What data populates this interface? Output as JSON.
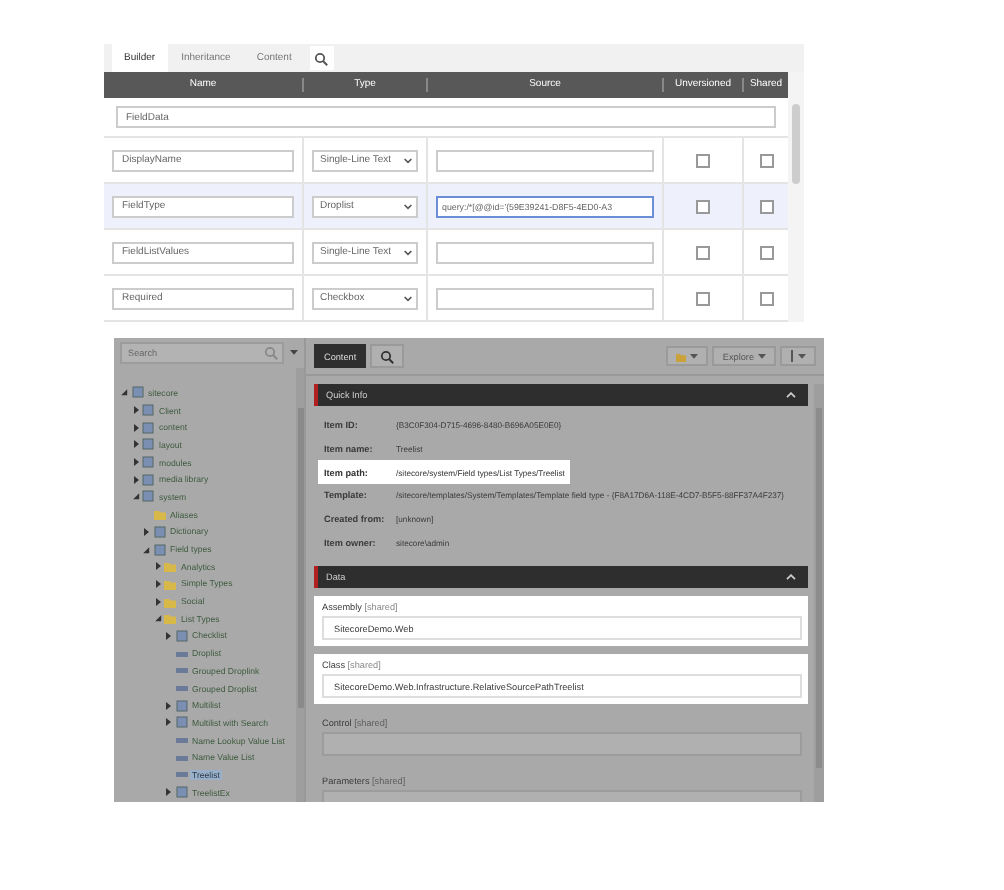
{
  "builder": {
    "tabs": [
      {
        "label": "Builder",
        "selected": true
      },
      {
        "label": "Inheritance",
        "selected": false
      },
      {
        "label": "Content",
        "selected": false
      }
    ],
    "columns": [
      "Name",
      "Type",
      "Source",
      "Unversioned",
      "Shared"
    ],
    "section_name": "FieldData",
    "rows": [
      {
        "name": "DisplayName",
        "type": "Single-Line Text",
        "unversioned": false,
        "shared": false,
        "selected": false
      },
      {
        "name": "FieldType",
        "type": "Droplist",
        "source": "query:/*[@@id='{59E39241-D8F5-4ED0-A3",
        "unversioned": false,
        "shared": false,
        "selected": true
      },
      {
        "name": "FieldListValues",
        "type": "Single-Line Text",
        "unversioned": false,
        "shared": false,
        "selected": false
      },
      {
        "name": "Required",
        "type": "Checkbox",
        "unversioned": false,
        "shared": false,
        "selected": false
      }
    ]
  },
  "explorer": {
    "search": {
      "placeholder": "Search"
    },
    "tree": [
      {
        "label": "sitecore",
        "kind": "item",
        "expanded": true,
        "selected": false,
        "children": [
          {
            "label": "Client",
            "kind": "item",
            "expanded": false,
            "selected": false
          },
          {
            "label": "content",
            "kind": "item",
            "expanded": false,
            "selected": false
          },
          {
            "label": "layout",
            "kind": "item",
            "expanded": false,
            "selected": false
          },
          {
            "label": "modules",
            "kind": "item",
            "expanded": false,
            "selected": false
          },
          {
            "label": "media library",
            "kind": "item",
            "expanded": false,
            "selected": false
          },
          {
            "label": "system",
            "kind": "item",
            "expanded": true,
            "selected": false,
            "children": [
              {
                "label": "Aliases",
                "kind": "folder",
                "selected": false
              },
              {
                "label": "Dictionary",
                "kind": "item",
                "expanded": false,
                "selected": false
              },
              {
                "label": "Field types",
                "kind": "item",
                "expanded": true,
                "selected": false,
                "children": [
                  {
                    "label": "Analytics",
                    "kind": "folder",
                    "expanded": false,
                    "selected": false
                  },
                  {
                    "label": "Simple Types",
                    "kind": "folder",
                    "expanded": false,
                    "selected": false
                  },
                  {
                    "label": "Social",
                    "kind": "folder",
                    "expanded": false,
                    "selected": false
                  },
                  {
                    "label": "List Types",
                    "kind": "folder",
                    "expanded": true,
                    "selected": false,
                    "children": [
                      {
                        "label": "Checklist",
                        "kind": "item",
                        "expanded": false,
                        "selected": false
                      },
                      {
                        "label": "Droplist",
                        "kind": "field",
                        "selected": false
                      },
                      {
                        "label": "Grouped Droplink",
                        "kind": "field",
                        "selected": false
                      },
                      {
                        "label": "Grouped Droplist",
                        "kind": "field",
                        "selected": false
                      },
                      {
                        "label": "Multilist",
                        "kind": "item",
                        "expanded": false,
                        "selected": false
                      },
                      {
                        "label": "Multilist with Search",
                        "kind": "item",
                        "expanded": false,
                        "selected": false
                      },
                      {
                        "label": "Name Lookup Value List",
                        "kind": "field",
                        "selected": false
                      },
                      {
                        "label": "Name Value List",
                        "kind": "field",
                        "selected": false
                      },
                      {
                        "label": "Treelist",
                        "kind": "field",
                        "selected": true
                      },
                      {
                        "label": "TreelistEx",
                        "kind": "item",
                        "expanded": false,
                        "selected": false
                      }
                    ]
                  }
                ]
              }
            ]
          }
        ]
      }
    ]
  },
  "editor": {
    "tabs": [
      {
        "label": "Content",
        "selected": true
      }
    ],
    "explore_button": "Explore",
    "quick_info": {
      "title": "Quick Info",
      "expanded": true,
      "rows": [
        {
          "label": "Item ID:",
          "value": "{B3C0F304-D715-4696-8480-B696A05E0E0}",
          "highlighted": false
        },
        {
          "label": "Item name:",
          "value": "Treelist",
          "highlighted": false
        },
        {
          "label": "Item path:",
          "value": "/sitecore/system/Field types/List Types/Treelist",
          "highlighted": true
        },
        {
          "label": "Template:",
          "value": "/sitecore/templates/System/Templates/Template field type - {F8A17D6A-118E-4CD7-B5F5-88FF37A4F237}",
          "highlighted": false
        },
        {
          "label": "Created from:",
          "value": "[unknown]",
          "highlighted": false
        },
        {
          "label": "Item owner:",
          "value": "sitecore\\admin",
          "highlighted": false
        }
      ]
    },
    "data": {
      "title": "Data",
      "expanded": true,
      "fields": [
        {
          "label": "Assembly",
          "note": "[shared]",
          "value": "SitecoreDemo.Web",
          "highlighted": true
        },
        {
          "label": "Class",
          "note": "[shared]",
          "value": "SitecoreDemo.Web.Infrastructure.RelativeSourcePathTreelist",
          "highlighted": true
        },
        {
          "label": "Control",
          "note": "[shared]",
          "highlighted": false
        },
        {
          "label": "Parameters",
          "note": "[shared]",
          "highlighted": false
        }
      ]
    }
  }
}
